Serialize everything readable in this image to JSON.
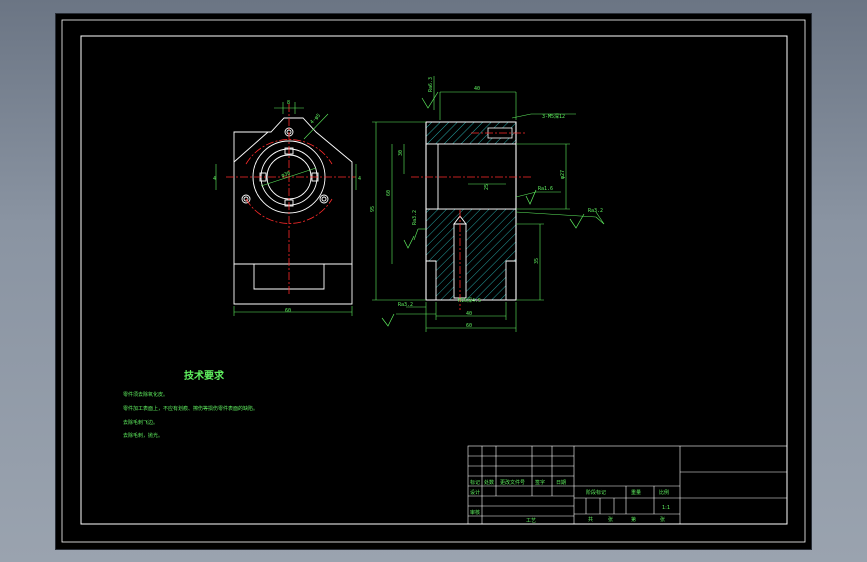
{
  "colors": {
    "background": "#000000",
    "outline": "#ffffff",
    "dimension": "#5ff05f",
    "centerline": "#ff2a2a",
    "hatch": "#2fd0d0",
    "frame": "#ffffff"
  },
  "drawing": {
    "left_view": {
      "dims": {
        "width": "60",
        "top": "8",
        "hole": "4-φ5",
        "circle": "φ36",
        "side": "4",
        "side_r": "4"
      }
    },
    "section_view": {
      "dims": {
        "top_width": "40",
        "thread": "3-M5深12",
        "h1": "30",
        "h2": "60",
        "h3": "95",
        "bore": "φ27",
        "mid": "25",
        "lower": "35",
        "drill": "M16深4.5",
        "w1": "40",
        "w2": "60"
      },
      "roughness": [
        "Ra6.3",
        "Ra1.6",
        "Ra3.2",
        "Ra3.2",
        "Ra3.2"
      ]
    }
  },
  "tech_requirements": {
    "title": "技术要求",
    "lines": [
      "零件须去除氧化皮。",
      "零件加工表面上，不应有划痕、擦伤等损伤零件表面的缺陷。",
      "去除毛刺飞边。",
      "去除毛刺，抛光。"
    ]
  },
  "title_block": {
    "rev_headers": [
      "标记",
      "处数",
      "更改文件号",
      "签字",
      "日期"
    ],
    "design": "设计",
    "check": "审核",
    "process": "工艺",
    "approve": "批准",
    "stage_label": "阶段标记",
    "weight_label": "重量",
    "scale_label": "比例",
    "scale": "1:1",
    "sheet_total": "共",
    "sheet_label": "张",
    "sheet_no": "第"
  }
}
